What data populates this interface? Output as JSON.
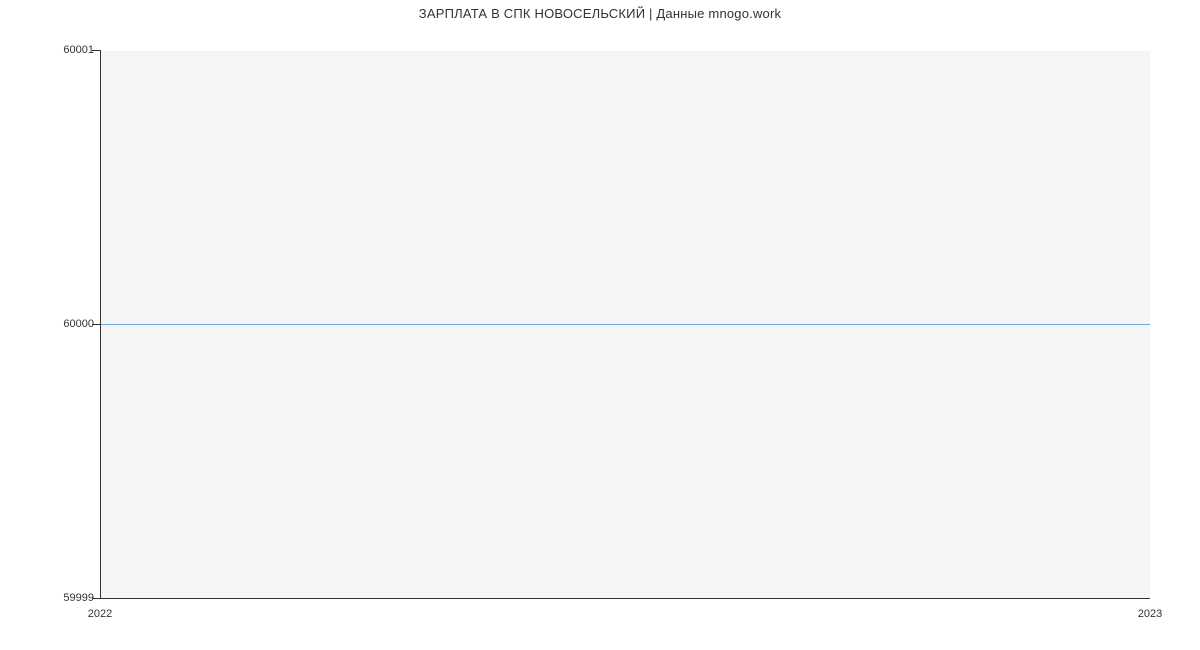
{
  "chart_data": {
    "type": "line",
    "title": "ЗАРПЛАТА В СПК НОВОСЕЛЬСКИЙ | Данные mnogo.work",
    "x": [
      2022,
      2023
    ],
    "values": [
      60000,
      60000
    ],
    "xlabel": "",
    "ylabel": "",
    "ylim": [
      59999,
      60001
    ],
    "xlim": [
      2022,
      2023
    ],
    "yticks": [
      59999,
      60000,
      60001
    ],
    "xticks": [
      2022,
      2023
    ]
  }
}
